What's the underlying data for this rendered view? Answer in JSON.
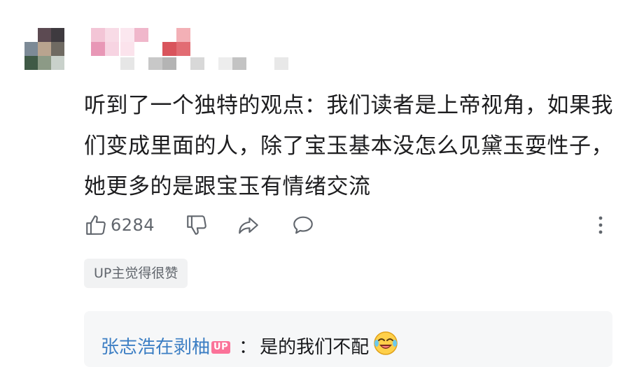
{
  "comment": {
    "text": "听到了一个独特的观点：我们读者是上帝视角，如果我们变成里面的人，除了宝玉基本没怎么见黛玉耍性子，她更多的是跟宝玉有情绪交流"
  },
  "actions": {
    "like_count": "6284",
    "like_icon": "thumbs-up-icon",
    "dislike_icon": "thumbs-down-icon",
    "share_icon": "share-icon",
    "reply_icon": "reply-bubble-icon",
    "more_icon": "more-vertical-icon"
  },
  "up_liked_label": "UP主觉得很赞",
  "reply": {
    "username": "张志浩在剥柚",
    "badge": "UP",
    "separator": "：",
    "text": "是的我们不配",
    "emoji": "laughing-tears-emoji"
  },
  "colors": {
    "accent_link": "#3d7fc4",
    "up_badge": "#fb7299",
    "icon_gray": "#61666d",
    "chip_bg": "#f1f2f3",
    "reply_bg": "#f6f7f8"
  }
}
